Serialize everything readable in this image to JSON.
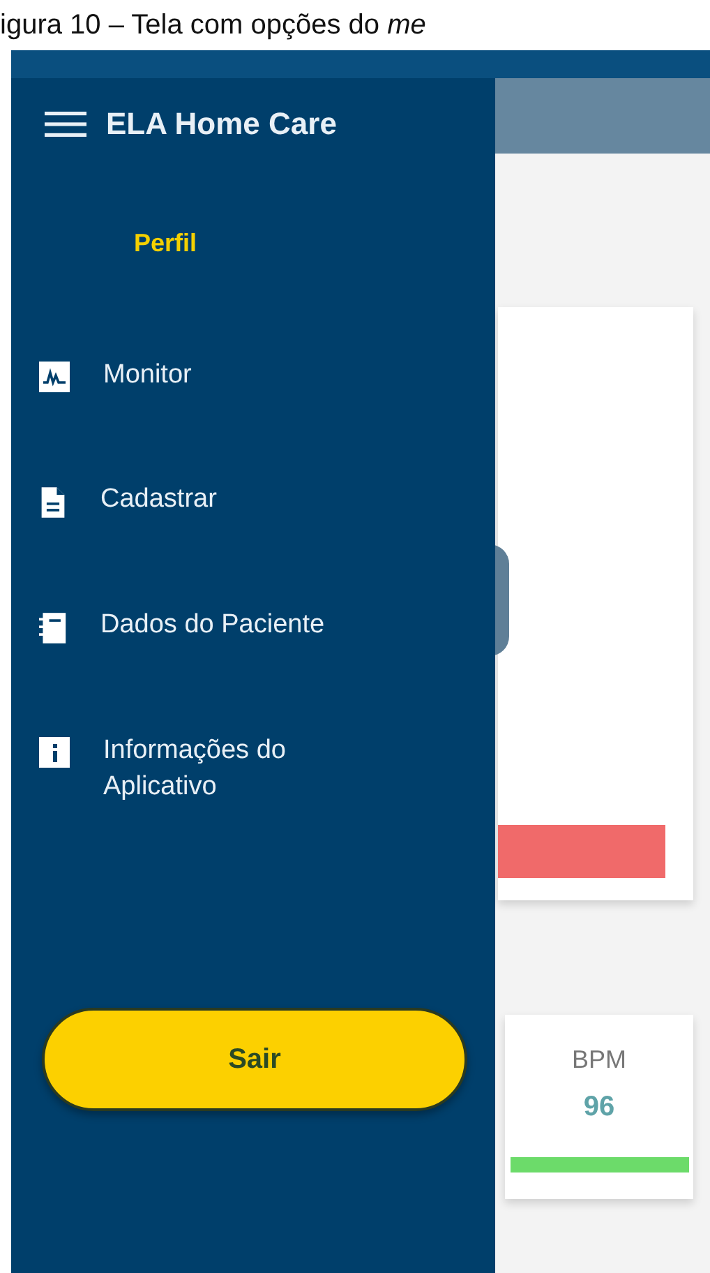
{
  "caption": "igura 10 – Tela com opções do *me*",
  "app": {
    "title": "ELA Home Care"
  },
  "drawer": {
    "profile": "Perfil",
    "items": [
      {
        "label": "Monitor"
      },
      {
        "label": "Cadastrar"
      },
      {
        "label": "Dados do Paciente"
      },
      {
        "label": "Informações do\n Aplicativo"
      }
    ],
    "logout": "Sair"
  },
  "bpm_card": {
    "label": "BPM",
    "value": "96"
  }
}
